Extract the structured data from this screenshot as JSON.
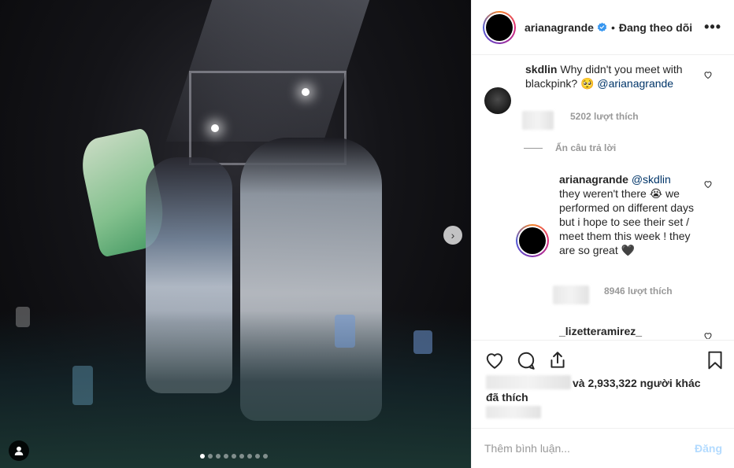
{
  "header": {
    "username": "arianagrande",
    "separator": "•",
    "follow_status": "Đang theo dõi",
    "more_icon": "more-horizontal-icon"
  },
  "comments": [
    {
      "username": "skdlin",
      "text": "Why didn't you meet with blackpink? 🥺",
      "mention": "@arianagrande",
      "likes": "5202 lượt thích"
    }
  ],
  "hide_replies": "Ẩn câu trả lời",
  "reply": {
    "username": "arianagrande",
    "mention": "@skdlin",
    "text": "they weren't there 😭 we performed on different days but i hope to see their set / meet them this week ! they are so great 🖤",
    "likes": "8946 lượt thích"
  },
  "next_comment_username": "_lizetteramirez_",
  "likes_summary": {
    "others": "và 2,933,322 người khác",
    "liked": "đã thích"
  },
  "comment_input": {
    "placeholder": "Thêm bình luận...",
    "post_label": "Đăng"
  },
  "carousel": {
    "dot_count": 9,
    "active_index": 0
  }
}
